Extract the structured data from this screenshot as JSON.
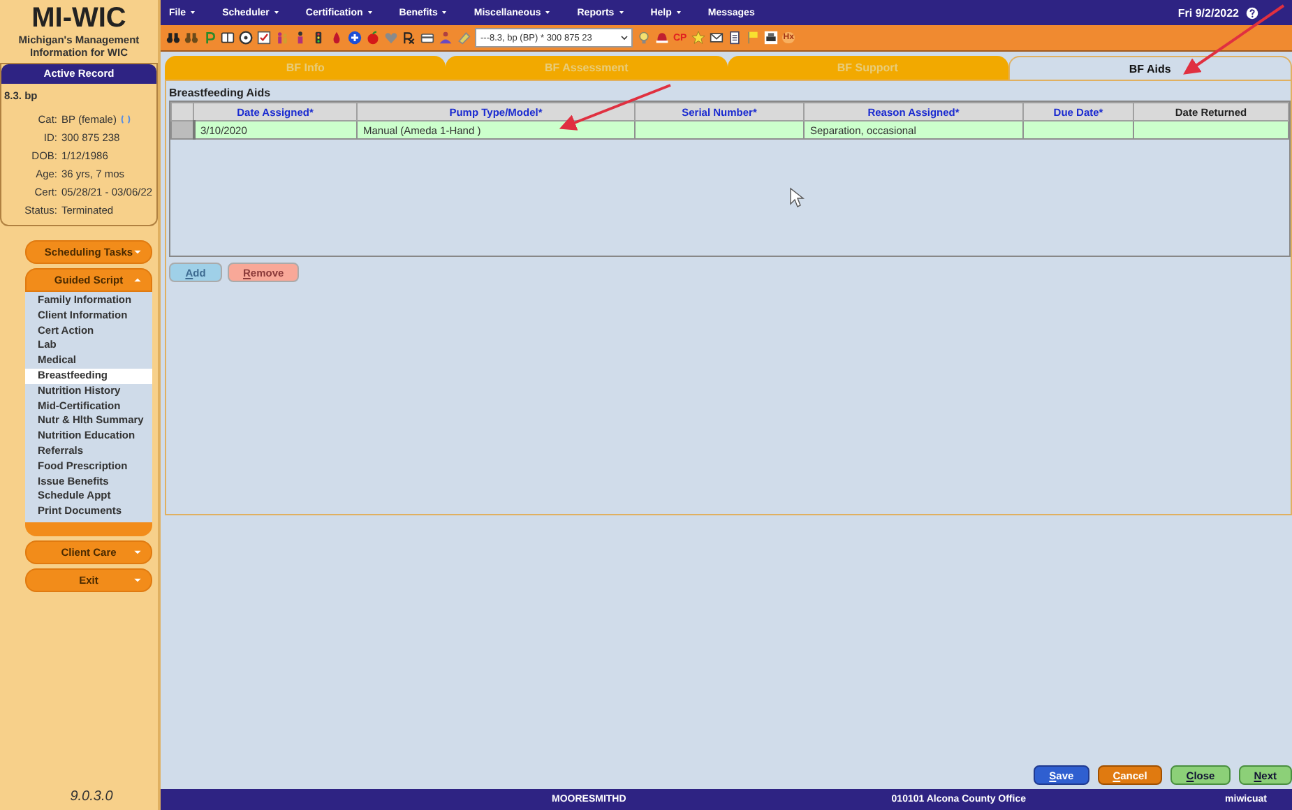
{
  "app": {
    "title": "MI-WIC",
    "subtitle": "Michigan's Management Information for WIC",
    "version": "9.0.3.0"
  },
  "active_record": {
    "header": "Active Record",
    "name": "8.3. bp",
    "fields": [
      {
        "label": "Cat:",
        "value": "BP (female)"
      },
      {
        "label": "ID:",
        "value": "300 875 238"
      },
      {
        "label": "DOB:",
        "value": "1/12/1986"
      },
      {
        "label": "Age:",
        "value": "36 yrs, 7 mos"
      },
      {
        "label": "Cert:",
        "value": "05/28/21 - 03/06/22"
      },
      {
        "label": "Status:",
        "value": "Terminated"
      }
    ]
  },
  "nav": [
    {
      "label": "Scheduling Tasks",
      "expanded": false
    },
    {
      "label": "Guided Script",
      "expanded": true,
      "items": [
        {
          "label": "Family Information",
          "selected": false
        },
        {
          "label": "Client Information",
          "selected": false
        },
        {
          "label": "Cert Action",
          "selected": false
        },
        {
          "label": "Lab",
          "selected": false
        },
        {
          "label": "Medical",
          "selected": false
        },
        {
          "label": "Breastfeeding",
          "selected": true
        },
        {
          "label": "Nutrition History",
          "selected": false
        },
        {
          "label": "Mid-Certification",
          "selected": false
        },
        {
          "label": "Nutr & Hlth Summary",
          "selected": false
        },
        {
          "label": "Nutrition Education",
          "selected": false
        },
        {
          "label": "Referrals",
          "selected": false
        },
        {
          "label": "Food Prescription",
          "selected": false
        },
        {
          "label": "Issue Benefits",
          "selected": false
        },
        {
          "label": "Schedule Appt",
          "selected": false
        },
        {
          "label": "Print Documents",
          "selected": false
        }
      ]
    },
    {
      "label": "Client Care",
      "expanded": false
    },
    {
      "label": "Exit",
      "expanded": false
    }
  ],
  "menu": [
    {
      "label": "File",
      "dropdown": true
    },
    {
      "label": "Scheduler",
      "dropdown": true
    },
    {
      "label": "Certification",
      "dropdown": true
    },
    {
      "label": "Benefits",
      "dropdown": true
    },
    {
      "label": "Miscellaneous",
      "dropdown": true
    },
    {
      "label": "Reports",
      "dropdown": true
    },
    {
      "label": "Help",
      "dropdown": true
    },
    {
      "label": "Messages",
      "dropdown": false
    }
  ],
  "date": "Fri 9/2/2022",
  "toolbar": {
    "client_select": "---8.3, bp (BP) * 300 875 23",
    "cp_label": "CP",
    "hx_label": "Hx"
  },
  "tabs": [
    {
      "label": "BF Info",
      "selected": false
    },
    {
      "label": "BF Assessment",
      "selected": false
    },
    {
      "label": "BF Support",
      "selected": false
    },
    {
      "label": "BF Aids",
      "selected": true
    }
  ],
  "table": {
    "title": "Breastfeeding Aids",
    "columns": [
      {
        "label": "Date Assigned*",
        "required": true
      },
      {
        "label": "Pump Type/Model*",
        "required": true
      },
      {
        "label": "Serial Number*",
        "required": true
      },
      {
        "label": "Reason Assigned*",
        "required": true
      },
      {
        "label": "Due Date*",
        "required": true
      },
      {
        "label": "Date Returned",
        "required": false
      }
    ],
    "rows": [
      {
        "selected": true,
        "cells": [
          "3/10/2020",
          "Manual (Ameda 1-Hand )",
          "",
          "Separation, occasional",
          "",
          ""
        ]
      }
    ]
  },
  "grid_buttons": [
    {
      "label": "Add",
      "disabled": true,
      "kind": "info"
    },
    {
      "label": "Remove",
      "disabled": true,
      "kind": "danger"
    }
  ],
  "footer_buttons": [
    {
      "label": "Save",
      "kind": "primary"
    },
    {
      "label": "Cancel",
      "kind": "warning"
    },
    {
      "label": "Close",
      "kind": "success"
    },
    {
      "label": "Next",
      "kind": "success"
    }
  ],
  "status_bar": [
    "MOORESMITHD",
    "010101 Alcona County Office",
    "miwicuat"
  ]
}
